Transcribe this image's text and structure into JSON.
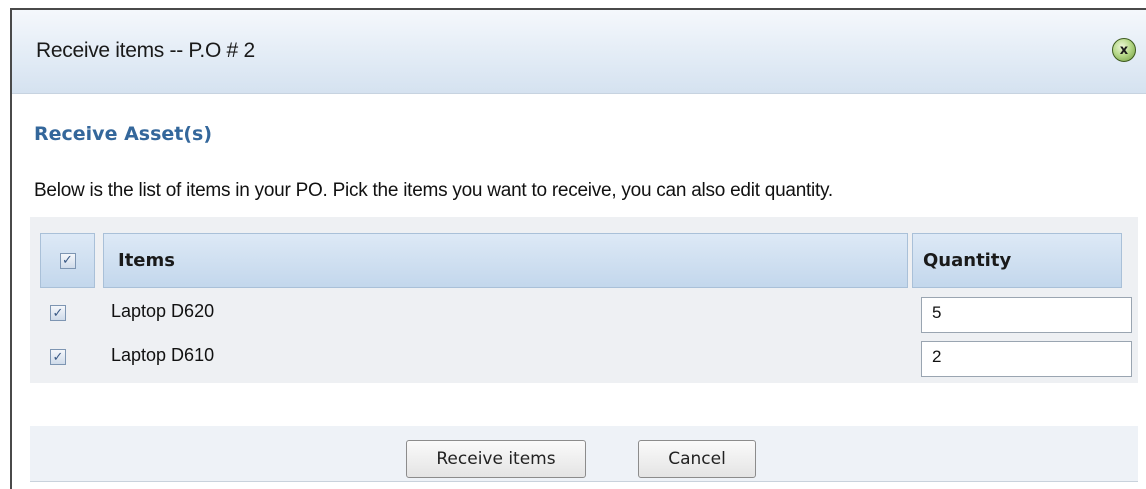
{
  "dialog": {
    "title": "Receive items -- P.O # 2",
    "close_icon": "close-circle-icon",
    "close_glyph": "x"
  },
  "section": {
    "heading": "Receive Asset(s)",
    "instructions": "Below is the list of items in your PO. Pick the items you want to receive, you can also edit quantity."
  },
  "table": {
    "select_all_checked": true,
    "columns": [
      "Items",
      "Quantity"
    ],
    "rows": [
      {
        "checked": true,
        "item": "Laptop D620",
        "quantity": "5"
      },
      {
        "checked": true,
        "item": "Laptop D610",
        "quantity": "2"
      }
    ]
  },
  "buttons": {
    "receive_label": "Receive items",
    "cancel_label": "Cancel"
  },
  "check_glyph": "✓",
  "colors": {
    "heading": "#34679b",
    "header_bg": "#d5e2f0",
    "close_button": "#8fbf5a"
  }
}
